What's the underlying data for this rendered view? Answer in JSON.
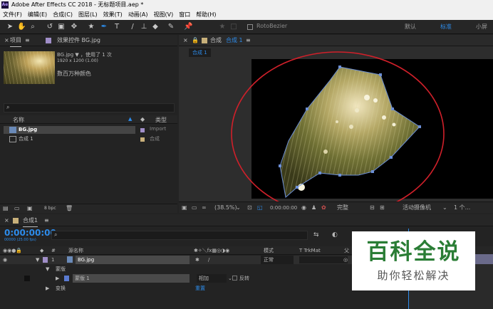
{
  "window": {
    "app_badge": "Ae",
    "title": "Adobe After Effects CC 2018 - 无标题项目.aep *"
  },
  "menu": [
    "文件(F)",
    "编辑(E)",
    "合成(C)",
    "图层(L)",
    "效果(T)",
    "动画(A)",
    "视图(V)",
    "窗口",
    "帮助(H)"
  ],
  "toolbar": {
    "rotobezier": "RotoBezier",
    "workspaces": [
      "默认",
      "标准",
      "小屏"
    ],
    "active_workspace": "标准"
  },
  "project": {
    "tab": "项目",
    "effects_tab": "效果控件 BG.jpg",
    "item_name": "BG.jpg",
    "used": "，使用了 1 次",
    "dims": "1920 x 1200 (1.00)",
    "colors": "数百万种颜色",
    "col_name": "名称",
    "col_type": "类型",
    "rows": [
      {
        "name": "BG.jpg",
        "type": "Import"
      },
      {
        "name": "合成 1",
        "type": "合成"
      }
    ],
    "bpc": "8 bpc"
  },
  "comp": {
    "tab_prefix": "合成",
    "tab_name": "合成 1",
    "crumb": "合成 1",
    "zoom": "(38.5%)",
    "time": "0:00:00:00",
    "quality": "完整",
    "camera": "活动摄像机",
    "views": "1 个..."
  },
  "timeline": {
    "tab": "合成1",
    "time": "0:00:00:00",
    "frames": "00000 (25.00 fps)",
    "col_source": "源名称",
    "col_mode": "模式",
    "col_trk": "T  TrkMat",
    "col_parent": "父",
    "layer": {
      "num": "1",
      "name": "BG.jpg",
      "mode": "正常"
    },
    "mask_group": "蒙版",
    "mask": {
      "name": "蒙版 1",
      "mode": "相加",
      "invert": "反转"
    },
    "transform": "变换",
    "reset": "重置"
  },
  "watermark": {
    "title": "百科全说",
    "subtitle": "助你轻松解决"
  },
  "colors": {
    "accent_blue": "#2d8ceb",
    "annotation_red": "#d0202a",
    "watermark_green": "#2a7d35",
    "mask_path": "#6c8fd6"
  }
}
